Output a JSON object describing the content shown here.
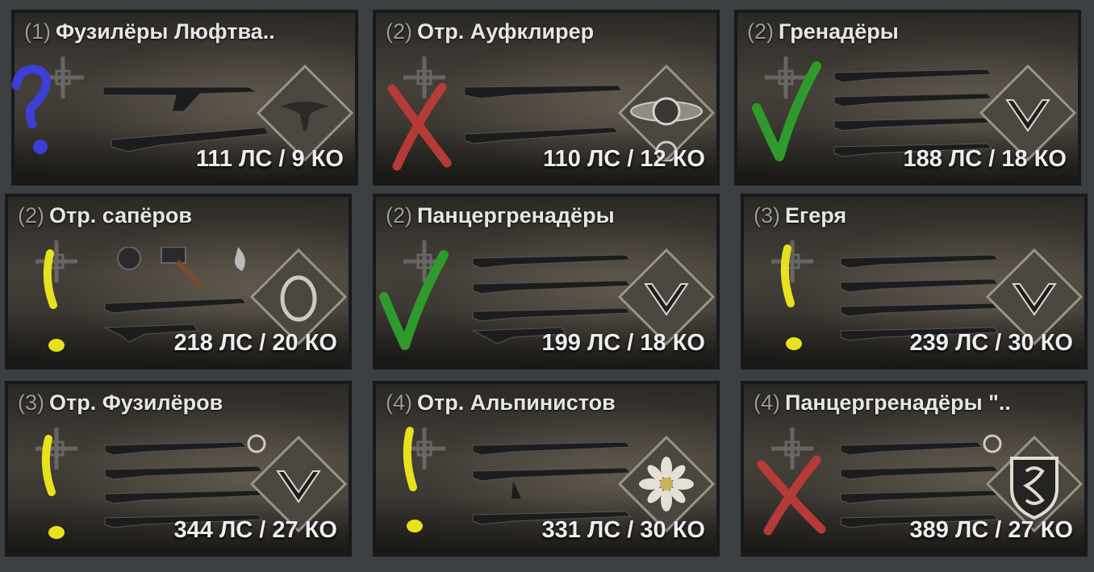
{
  "squads": [
    {
      "tier": "(1)",
      "name": "Фузилёры Люфтва..",
      "stats": "111 ЛС / 9 КО",
      "mark": "question",
      "emblem": "eagle-icon"
    },
    {
      "tier": "(2)",
      "name": "Отр. Ауфклирер",
      "stats": "110 ЛС / 12 КО",
      "mark": "cross",
      "emblem": "recon-badge-icon"
    },
    {
      "tier": "(2)",
      "name": "Гренадёры",
      "stats": "188 ЛС / 18 КО",
      "mark": "check",
      "emblem": "chevron-rank-icon"
    },
    {
      "tier": "(2)",
      "name": "Отр. сапёров",
      "stats": "218 ЛС / 20 КО",
      "mark": "exclaim",
      "emblem": "pioneer-badge-icon"
    },
    {
      "tier": "(2)",
      "name": "Панцергренадёры",
      "stats": "199 ЛС / 18 КО",
      "mark": "check",
      "emblem": "chevron-rank-icon"
    },
    {
      "tier": "(3)",
      "name": "Егеря",
      "stats": "239 ЛС / 30 КО",
      "mark": "exclaim",
      "emblem": "chevron-rank-icon"
    },
    {
      "tier": "(3)",
      "name": "Отр. Фузилёров",
      "stats": "344 ЛС / 27 КО",
      "mark": "exclaim",
      "emblem": "chevron-rank-icon"
    },
    {
      "tier": "(4)",
      "name": "Отр. Альпинистов",
      "stats": "331 ЛС / 30 КО",
      "mark": "exclaim",
      "emblem": "edelweiss-icon"
    },
    {
      "tier": "(4)",
      "name": "Панцергренадёры \"..",
      "stats": "389 ЛС / 27 КО",
      "mark": "cross",
      "emblem": "division-shield-icon"
    }
  ],
  "colors": {
    "question": "#3b3fd6",
    "cross": "#b63a36",
    "check": "#2f9a2c",
    "exclaim": "#e8e11e"
  }
}
